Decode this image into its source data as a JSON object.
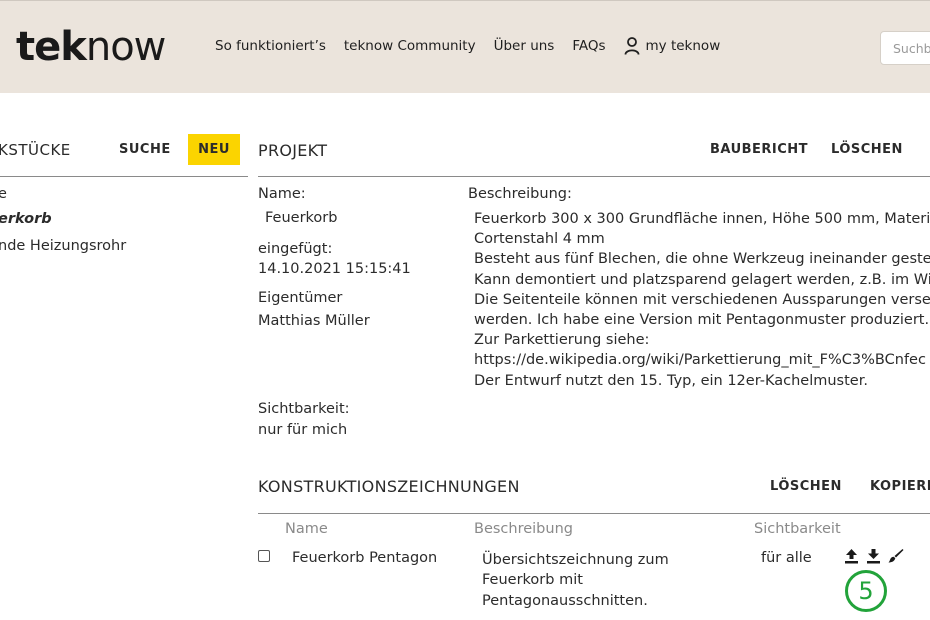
{
  "header": {
    "logo_bold": "tek",
    "logo_light": "now",
    "nav": [
      {
        "label": "So funktioniert’s"
      },
      {
        "label": "teknow Community"
      },
      {
        "label": "Über uns"
      },
      {
        "label": "FAQs"
      }
    ],
    "my_teknow": "my teknow",
    "search_placeholder": "Suchbe"
  },
  "left": {
    "title": "KSTÜCKE",
    "suche_label": "SUCHE",
    "neu_label": "NEU",
    "items": [
      {
        "label": "e"
      },
      {
        "label": "erkorb"
      },
      {
        "label": "nde Heizungsrohr"
      }
    ]
  },
  "project": {
    "title": "PROJEKT",
    "baubericht_label": "BAUBERICHT",
    "loeschen_label": "LÖSCHEN",
    "name_label": "Name:",
    "name_value": "Feuerkorb",
    "inserted_label": "eingefügt:",
    "inserted_value": "14.10.2021 15:15:41",
    "owner_label": "Eigentümer",
    "owner_value": "Matthias Müller",
    "visibility_label": "Sichtbarkeit:",
    "visibility_value": "nur für mich",
    "description_label": "Beschreibung:",
    "description_lines": [
      "Feuerkorb 300 x 300 Grundfläche innen, Höhe 500 mm, Materi",
      "Cortenstahl 4 mm",
      "Besteht aus fünf Blechen, die ohne Werkzeug ineinander gested",
      "Kann demontiert und platzsparend gelagert werden, z.B. im Wir",
      "Die Seitenteile können mit verschiedenen Aussparungen verse",
      "werden. Ich habe eine Version mit Pentagonmuster produziert.",
      "Zur Parkettierung siehe:",
      "https://de.wikipedia.org/wiki/Parkettierung_mit_F%C3%BCnfec",
      "Der Entwurf nutzt den 15. Typ, ein 12er-Kachelmuster."
    ]
  },
  "drawings": {
    "title": "KONSTRUKTIONSZEICHNUNGEN",
    "loeschen_label": "LÖSCHEN",
    "kopieren_label": "KOPIERE",
    "columns": [
      "Name",
      "Beschreibung",
      "Sichtbarkeit"
    ],
    "rows": [
      {
        "name": "Feuerkorb Pentagon",
        "description_lines": [
          "Übersichtszeichnung zum",
          "Feuerkorb mit",
          "Pentagonausschnitten."
        ],
        "visibility": "für alle"
      }
    ],
    "annotation_number": "5",
    "annotation_color": "#22a33a"
  },
  "colors": {
    "header_bg": "#ebe4dc",
    "accent_yellow": "#fbd400"
  }
}
